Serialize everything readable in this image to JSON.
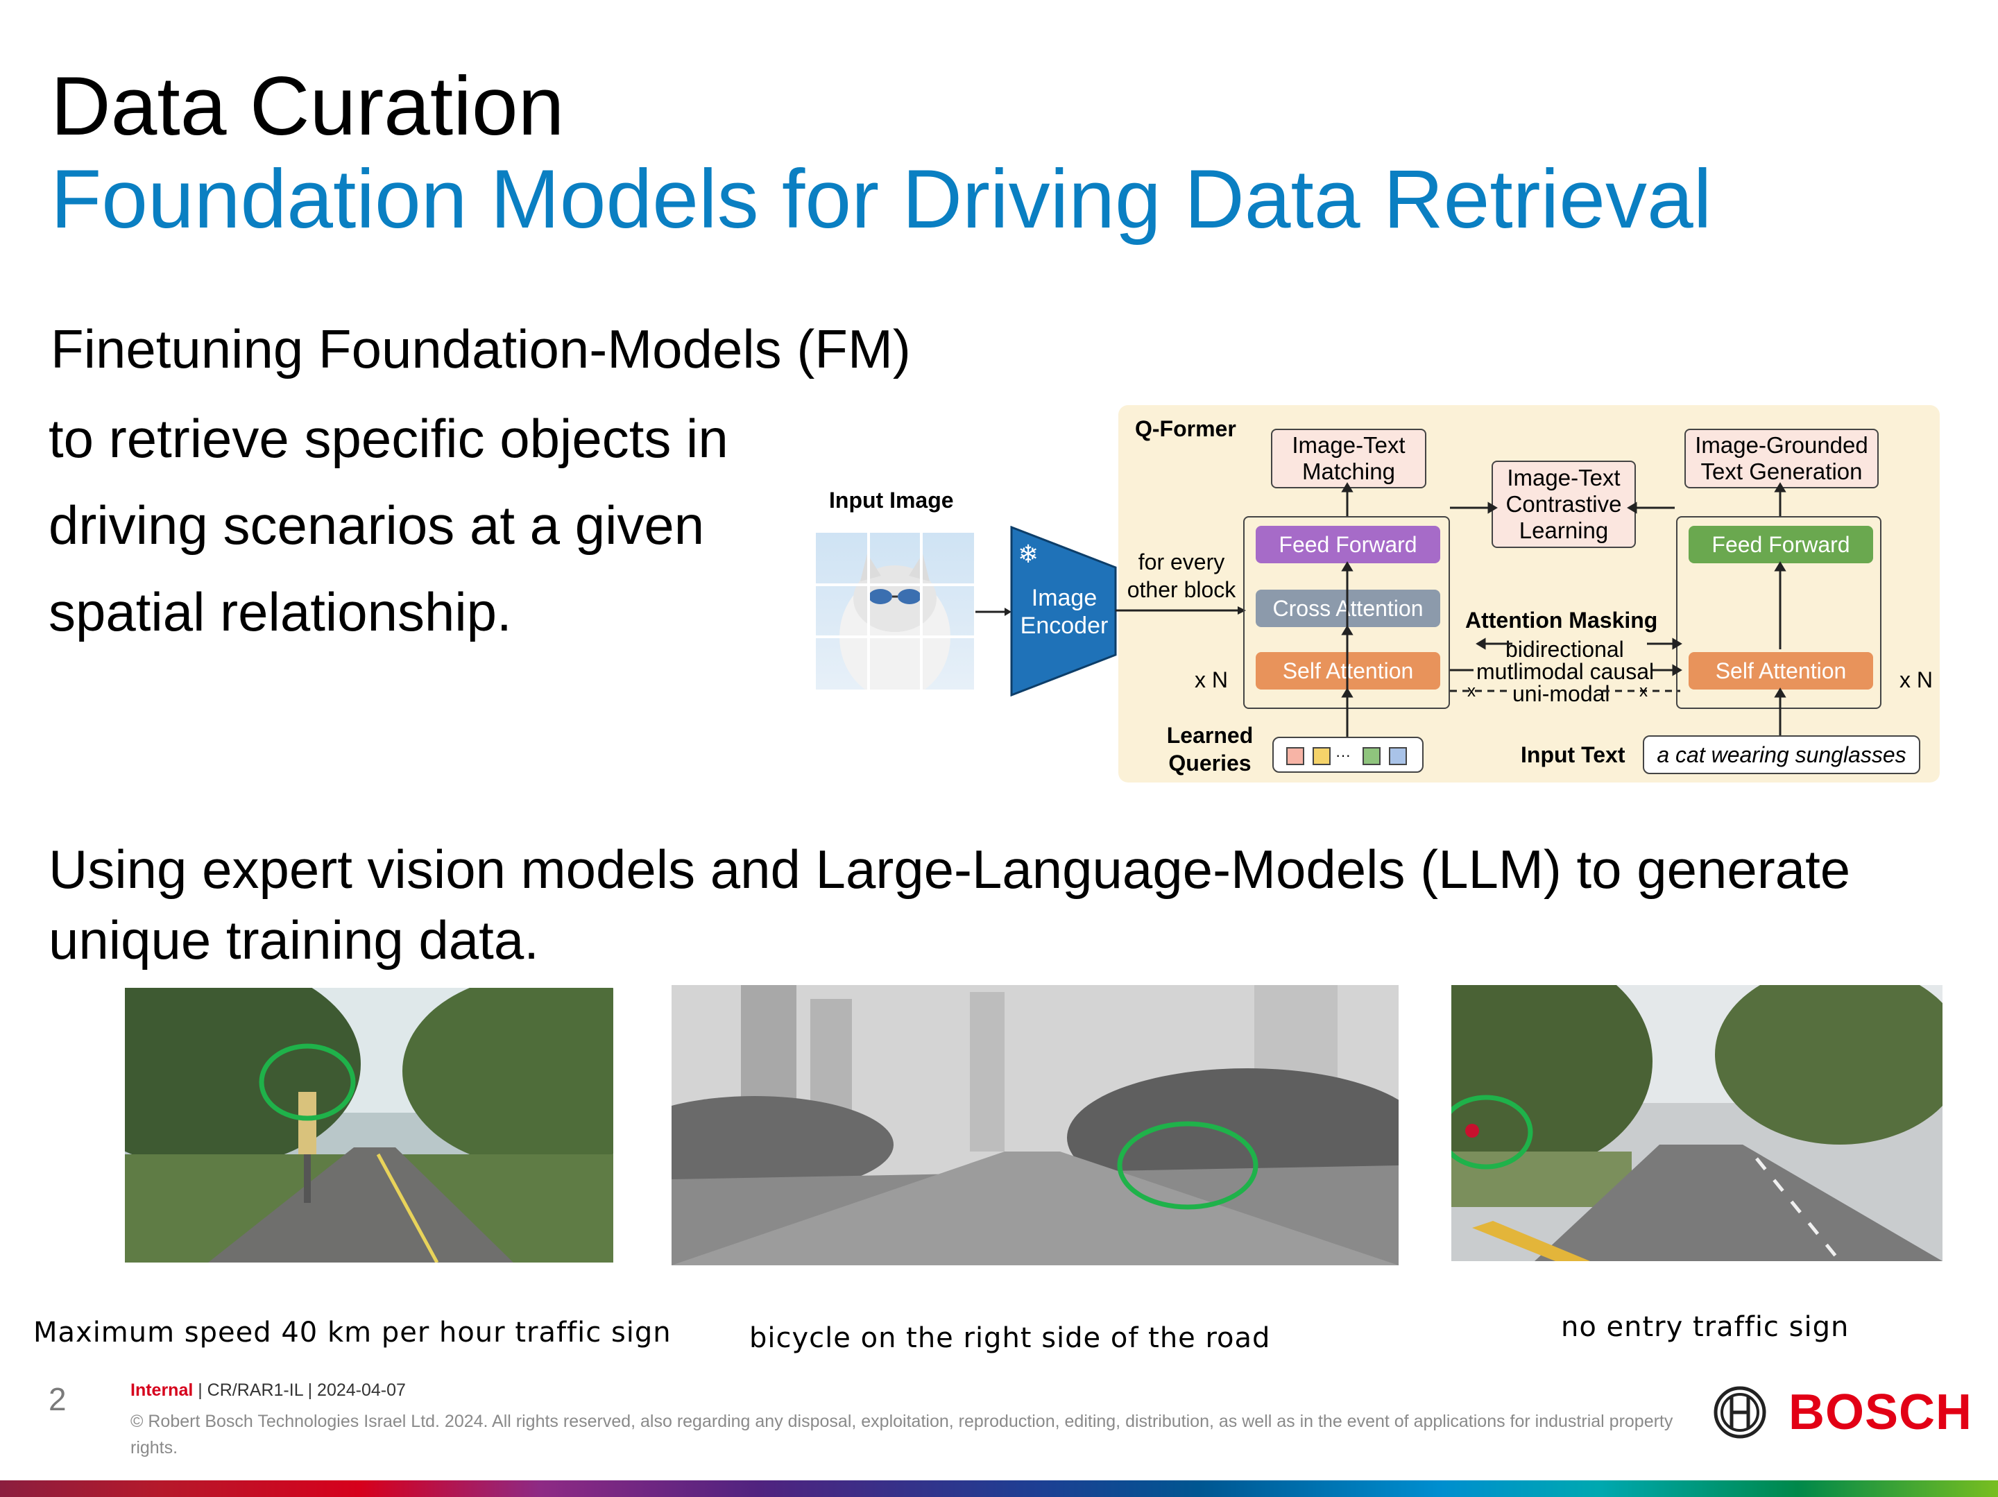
{
  "slide": {
    "title": "Data Curation",
    "subtitle": "Foundation Models for Driving Data Retrieval",
    "heading1": "Finetuning Foundation-Models (FM)",
    "body_lines": [
      "to retrieve specific objects in",
      "driving scenarios at a given",
      "spatial relationship."
    ],
    "heading2": "Using expert vision models and Large-Language-Models (LLM) to generate unique training data."
  },
  "diagram": {
    "qformer_label": "Q-Former",
    "input_image_label": "Input Image",
    "image_encoder_label": "Image Encoder",
    "for_every_label": "for every other block",
    "itm_label": "Image-Text Matching",
    "itc_label": "Image-Text Contrastive Learning",
    "itg_label": "Image-Grounded Text Generation",
    "feed_forward_left": "Feed Forward",
    "cross_attention": "Cross Attention",
    "self_attention_left": "Self Attention",
    "feed_forward_right": "Feed Forward",
    "self_attention_right": "Self Attention",
    "attention_masking": "Attention Masking",
    "mask_bidirectional": "bidirectional",
    "mask_causal": "mutlimodal causal",
    "mask_unimodal": "uni-modal",
    "xn_left": "x N",
    "xn_right": "x N",
    "learned_queries": "Learned Queries",
    "input_text_label": "Input Text",
    "input_text_value": "a cat wearing sunglasses",
    "colors": {
      "purple": "#a66bc8",
      "gray": "#8c9aab",
      "orange": "#e8935b",
      "green": "#6aa84f",
      "panel": "#fbf1d7",
      "encoder": "#1f72b8"
    }
  },
  "examples": [
    {
      "caption": "Maximum speed 40 km per hour traffic sign"
    },
    {
      "caption": "bicycle on the right side of the road"
    },
    {
      "caption": "no entry traffic sign"
    }
  ],
  "footer": {
    "page_number": "2",
    "classification": "Internal",
    "meta": " | CR/RAR1-IL | 2024-04-07",
    "copyright": "© Robert Bosch Technologies Israel Ltd. 2024. All rights reserved, also regarding any disposal, exploitation, reproduction, editing, distribution, as well as in the event of applications for industrial property rights.",
    "logo_text": "BOSCH"
  }
}
